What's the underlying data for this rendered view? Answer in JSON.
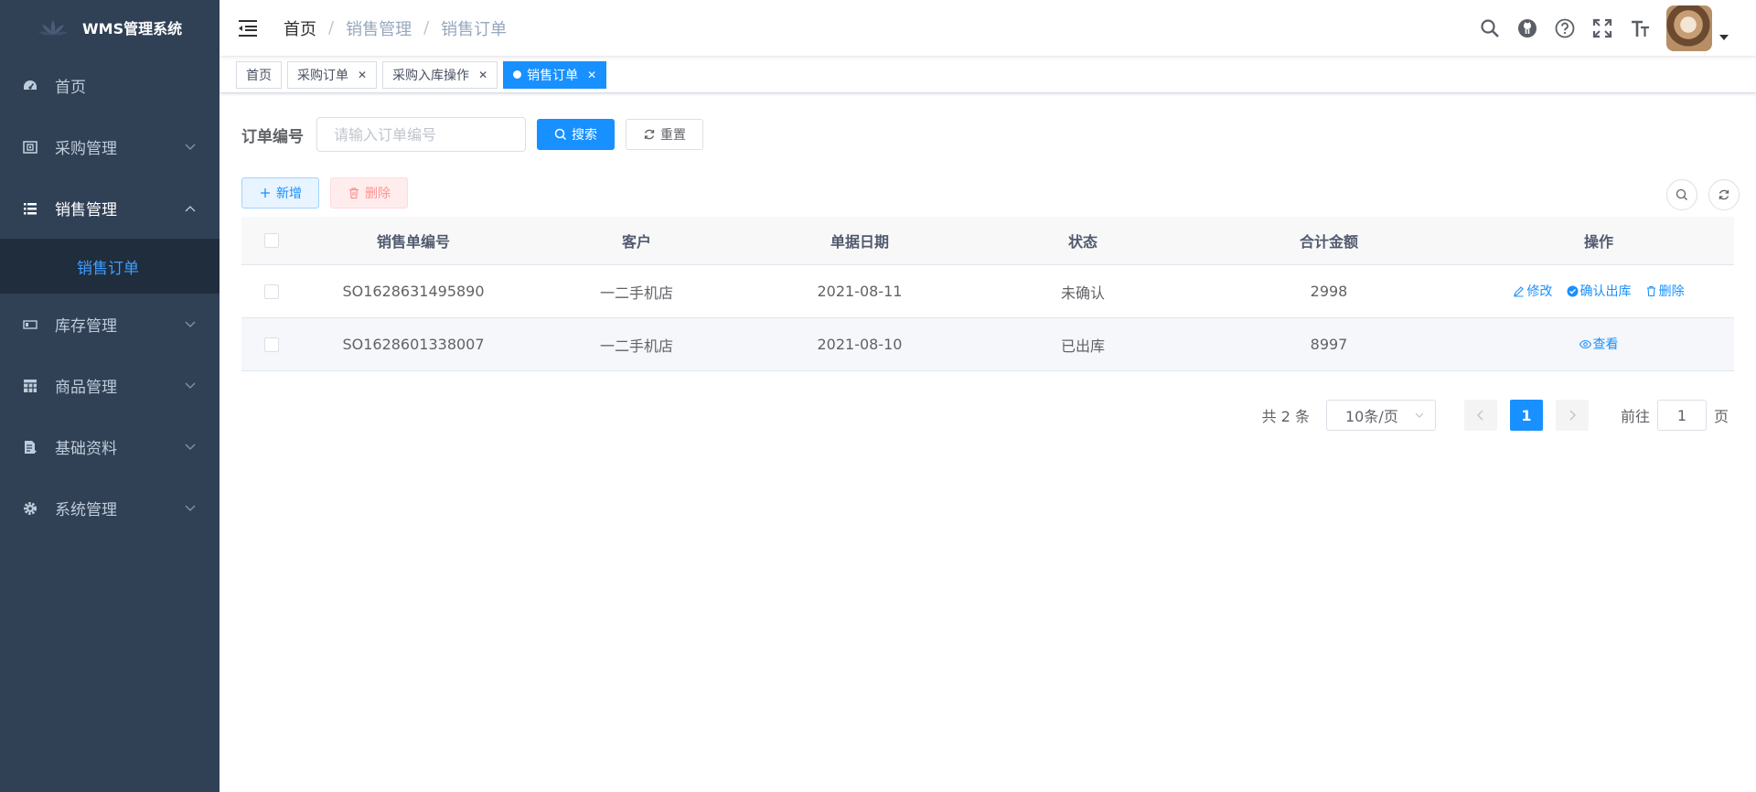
{
  "app": {
    "title": "WMS管理系统"
  },
  "sidebar": {
    "items": [
      {
        "label": "首页",
        "icon": "dashboard-icon"
      },
      {
        "label": "采购管理",
        "icon": "purchase-icon"
      },
      {
        "label": "销售管理",
        "icon": "list-icon"
      },
      {
        "label": "库存管理",
        "icon": "inventory-icon"
      },
      {
        "label": "商品管理",
        "icon": "table-icon"
      },
      {
        "label": "基础资料",
        "icon": "document-icon"
      },
      {
        "label": "系统管理",
        "icon": "gear-icon"
      }
    ],
    "sub_items": [
      {
        "label": "销售订单"
      }
    ]
  },
  "breadcrumb": [
    "首页",
    "销售管理",
    "销售订单"
  ],
  "tags": [
    {
      "label": "首页"
    },
    {
      "label": "采购订单"
    },
    {
      "label": "采购入库操作"
    },
    {
      "label": "销售订单"
    }
  ],
  "search": {
    "label": "订单编号",
    "placeholder": "请输入订单编号",
    "search_btn": "搜索",
    "reset_btn": "重置"
  },
  "toolbar": {
    "add_label": "新增",
    "delete_label": "删除"
  },
  "table": {
    "columns": [
      "销售单编号",
      "客户",
      "单据日期",
      "状态",
      "合计金额",
      "操作"
    ],
    "rows": [
      {
        "code": "SO1628631495890",
        "customer": "一二手机店",
        "date": "2021-08-11",
        "status": "未确认",
        "amount": "2998",
        "actions": [
          "修改",
          "确认出库",
          "删除"
        ]
      },
      {
        "code": "SO1628601338007",
        "customer": "一二手机店",
        "date": "2021-08-10",
        "status": "已出库",
        "amount": "8997",
        "actions": [
          "查看"
        ]
      }
    ]
  },
  "pagination": {
    "total_text": "共 2 条",
    "page_size": "10条/页",
    "current_page": "1",
    "goto_label": "前往",
    "goto_value": "1",
    "page_suffix": "页"
  },
  "colors": {
    "sidebar_bg": "#304156",
    "primary": "#1890ff",
    "submenu_bg": "#1f2d3d"
  }
}
